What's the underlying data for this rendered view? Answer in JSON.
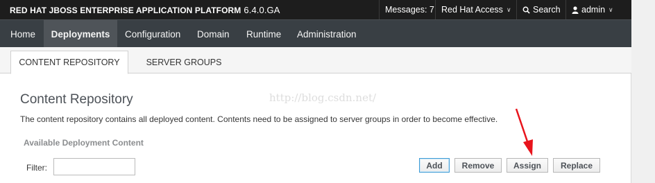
{
  "header": {
    "brand": "RED HAT JBOSS ENTERPRISE APPLICATION PLATFORM",
    "version": "6.4.0.GA",
    "messages": "Messages: 7",
    "red_hat_access": "Red Hat Access",
    "search": "Search",
    "user": "admin"
  },
  "nav": {
    "items": [
      "Home",
      "Deployments",
      "Configuration",
      "Domain",
      "Runtime",
      "Administration"
    ]
  },
  "tabs": [
    "CONTENT REPOSITORY",
    "SERVER GROUPS"
  ],
  "content": {
    "title": "Content Repository",
    "description": "The content repository contains all deployed content. Contents need to be assigned to server groups in order to become effective.",
    "section_label": "Available Deployment Content",
    "filter_label": "Filter:",
    "filter_value": ""
  },
  "buttons": {
    "add": "Add",
    "remove": "Remove",
    "assign": "Assign",
    "replace": "Replace"
  },
  "watermark": "http://blog.csdn.net/",
  "colors": {
    "topbar": "#1d1d1d",
    "navbar": "#393f44",
    "nav_active": "#4f5459",
    "primary_border": "#3f9cd6",
    "annotation_arrow": "#e8141c"
  }
}
